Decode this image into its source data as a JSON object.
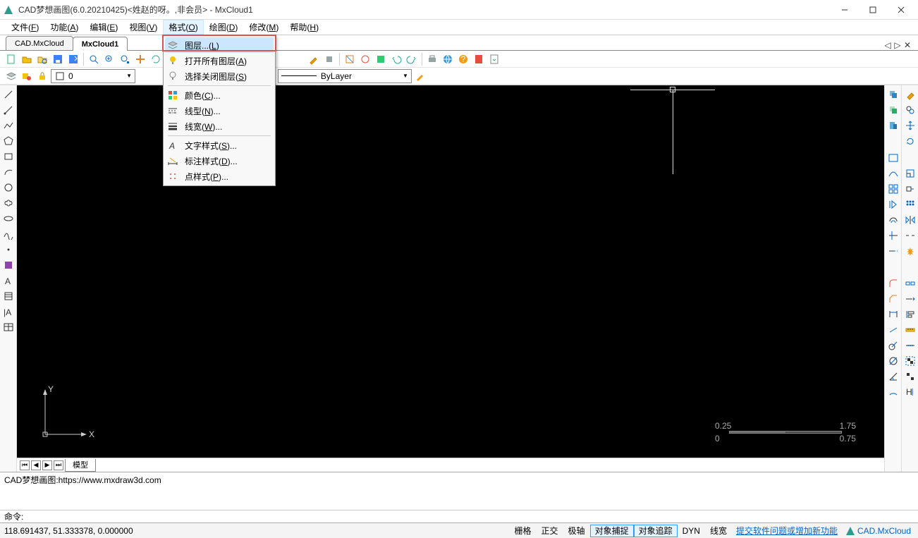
{
  "title": "CAD梦想画图(6.0.20210425)<姓赵的呀。,非会员> - MxCloud1",
  "menus": {
    "file": "文件(F)",
    "func": "功能(A)",
    "edit": "编辑(E)",
    "view": "视图(V)",
    "format": "格式(O)",
    "draw": "绘图(D)",
    "modify": "修改(M)",
    "help": "帮助(H)"
  },
  "tabs": {
    "t0": "CAD.MxCloud",
    "t1": "MxCloud1"
  },
  "layer_combo": "0",
  "linetype_combo": "ByLayer",
  "dropdown": {
    "layer": "图层...(L)",
    "openall": "打开所有图层(A)",
    "closesel": "选择关闭图层(S)",
    "color": "颜色(C)...",
    "ltype": "线型(N)...",
    "lweight": "线宽(W)...",
    "textstyle": "文字样式(S)...",
    "dimstyle": "标注样式(D)...",
    "ptstyle": "点样式(P)..."
  },
  "scale": {
    "a": "0",
    "b": "0.25",
    "c": "0.75",
    "d": "1.75"
  },
  "bottom_tab": "模型",
  "cmd_history": "CAD梦想画图:https://www.mxdraw3d.com",
  "cmd_prompt": "命令:",
  "status": {
    "coords": "118.691437,  51.333378,  0.000000",
    "grid": "栅格",
    "ortho": "正交",
    "polar": "极轴",
    "osnap": "对象捕捉",
    "otrack": "对象追踪",
    "dyn": "DYN",
    "lw": "线宽",
    "feedback": "提交软件问题或增加新功能",
    "brand": "CAD.MxCloud"
  }
}
